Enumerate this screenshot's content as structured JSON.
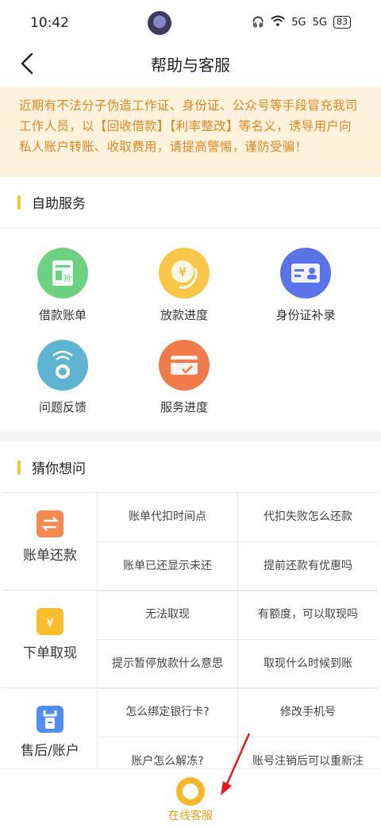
{
  "status": {
    "time": "10:42",
    "signal1": "5G",
    "signal2": "5G",
    "battery": "83"
  },
  "nav": {
    "title": "帮助与客服"
  },
  "notice": "近期有不法分子伪造工作证、身份证、公众号等手段冒充我司工作人员，以【回收借款】【利率整改】等名义，诱导用户向私人账户转账、收取费用，请提高警惕，谨防受骗！",
  "self_service": {
    "title": "自助服务",
    "items": [
      {
        "label": "借款账单",
        "glyph": "抢"
      },
      {
        "label": "放款进度",
        "glyph": "¥"
      },
      {
        "label": "身份证补录",
        "glyph": ""
      },
      {
        "label": "问题反馈",
        "glyph": ""
      },
      {
        "label": "服务进度",
        "glyph": ""
      }
    ]
  },
  "faq": {
    "title": "猜你想问",
    "groups": [
      {
        "category": "账单还款",
        "questions": [
          "账单代扣时间点",
          "代扣失败怎么还款",
          "账单已还显示未还",
          "提前还款有优惠吗"
        ]
      },
      {
        "category": "下单取现",
        "questions": [
          "无法取现",
          "有额度，可以取现吗",
          "提示暂停放款什么意思",
          "取现什么时候到账"
        ]
      },
      {
        "category": "售后/账户",
        "questions": [
          "怎么绑定银行卡?",
          "修改手机号",
          "账户怎么解冻?",
          "账号注销后可以重新注"
        ]
      }
    ]
  },
  "bottom": {
    "label": "在线客服"
  },
  "colors": {
    "accent": "#f6c52f",
    "notice_text": "#e48624",
    "arrow": "#e21b1b"
  }
}
